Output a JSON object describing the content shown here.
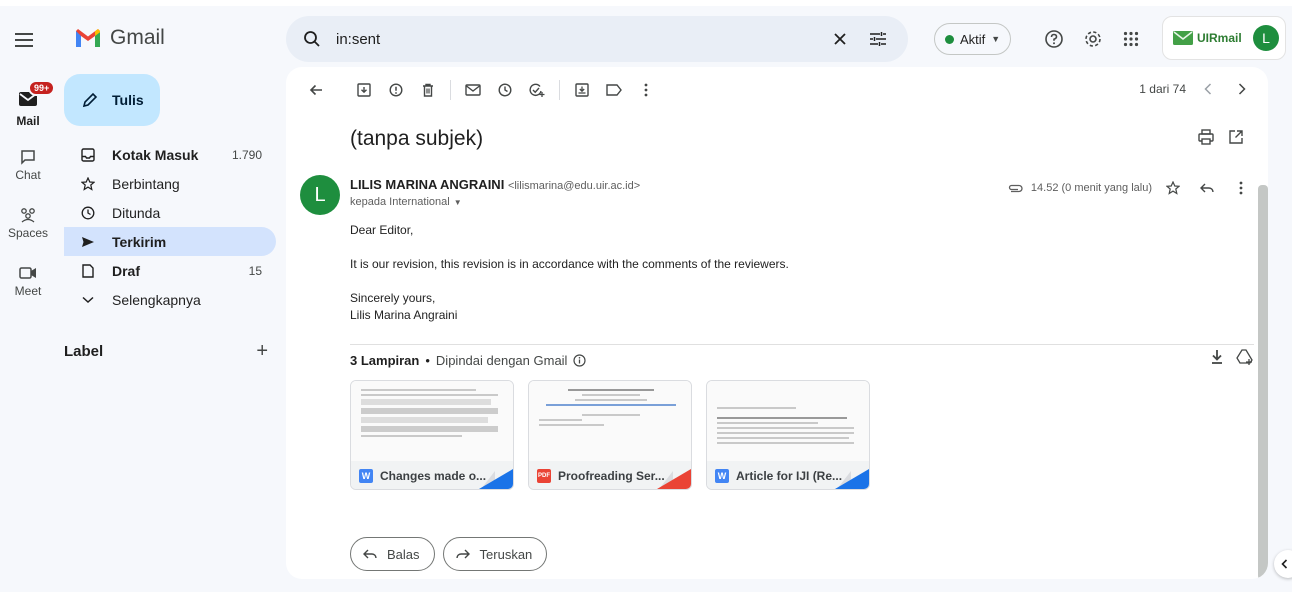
{
  "app": {
    "name": "Gmail"
  },
  "rail": {
    "mail_badge": "99+",
    "items": [
      {
        "label": "Mail"
      },
      {
        "label": "Chat"
      },
      {
        "label": "Spaces"
      },
      {
        "label": "Meet"
      }
    ]
  },
  "compose": {
    "label": "Tulis"
  },
  "nav": {
    "items": [
      {
        "label": "Kotak Masuk",
        "count": "1.790"
      },
      {
        "label": "Berbintang",
        "count": ""
      },
      {
        "label": "Ditunda",
        "count": ""
      },
      {
        "label": "Terkirim",
        "count": ""
      },
      {
        "label": "Draf",
        "count": "15"
      },
      {
        "label": "Selengkapnya",
        "count": ""
      }
    ],
    "label_section": "Label"
  },
  "search": {
    "query": "in:sent"
  },
  "status": {
    "label": "Aktif"
  },
  "account": {
    "org": "UIRmail",
    "initial": "L"
  },
  "pager": {
    "text": "1 dari 74"
  },
  "email": {
    "subject": "(tanpa subjek)",
    "sender_name": "LILIS MARINA ANGRAINI",
    "sender_email": "<lilismarina@edu.uir.ac.id>",
    "to": "kepada International",
    "time": "14.52 (0 menit yang lalu)",
    "avatar_initial": "L",
    "body": {
      "greeting": "Dear Editor,",
      "paragraph": "It is our revision, this revision is in accordance with the comments of the reviewers.",
      "closing": "Sincerely yours,",
      "signature": "Lilis Marina Angraini"
    }
  },
  "attachments": {
    "count_label": "3 Lampiran",
    "scan_label": "Dipindai dengan Gmail",
    "files": [
      {
        "name": "Changes made o...",
        "type": "W"
      },
      {
        "name": "Proofreading Ser...",
        "type": "PDF"
      },
      {
        "name": "Article for IJI (Re...",
        "type": "W"
      }
    ]
  },
  "actions": {
    "reply": "Balas",
    "forward": "Teruskan"
  },
  "colors": {
    "accent": "#c2e7ff",
    "active_nav": "#d3e3fd",
    "avatar": "#1e8e3e",
    "badge": "#c5221f"
  }
}
